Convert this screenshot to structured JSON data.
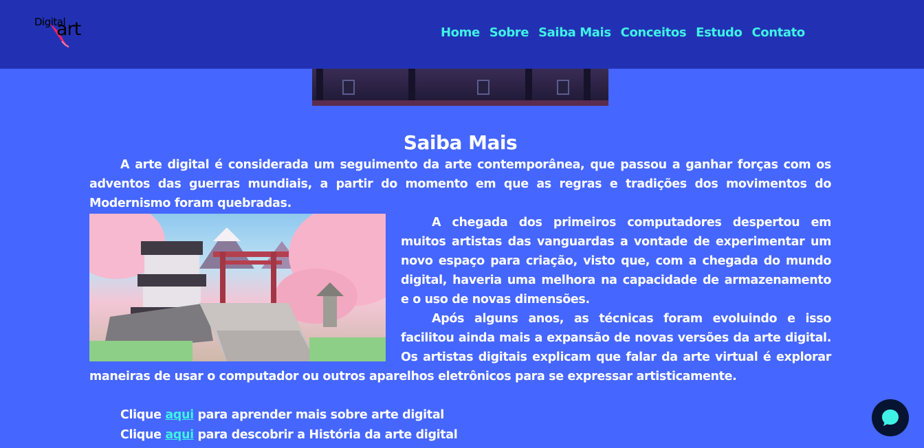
{
  "header": {
    "logo": {
      "line1": "Digital",
      "line2": "art",
      "brand_pink": "#e8236a"
    },
    "nav": [
      {
        "label": "Home"
      },
      {
        "label": "Sobre"
      },
      {
        "label": "Saiba Mais"
      },
      {
        "label": "Conceitos"
      },
      {
        "label": "Estudo"
      },
      {
        "label": "Contato"
      }
    ]
  },
  "colors": {
    "page_background": "#4566ff",
    "header_background": "#2231b4",
    "nav_link": "#3ff2e6",
    "chat_button": "#061431"
  },
  "main": {
    "top_image_icon": "pixel-art-scene-image",
    "title": "Saiba Mais",
    "paragraph1": "A arte digital é considerada um seguimento da arte contemporânea, que passou a ganhar forças com os adventos das guerras mundiais, a partir do momento em que as regras e tradições dos movimentos do Modernismo foram quebradas.",
    "image_icon": "cherry-blossom-castle-pixel-art-image",
    "paragraph2": "A chegada dos primeiros computadores despertou em muitos artistas das vanguardas a vontade de experimentar um novo espaço para criação, visto que, com a chegada do mundo digital, haveria uma melhora na capacidade de armazenamento e o uso de novas dimensões.",
    "paragraph3": "Após alguns anos, as técnicas foram evoluindo e isso facilitou ainda mais a expansão de novas versões da arte digital. Os artistas digitais explicam que falar da arte virtual é explorar maneiras de usar o computador ou outros aparelhos eletrônicos para se expressar artisticamente.",
    "links": [
      {
        "prefix": "Clique ",
        "link": "aqui",
        "suffix": " para aprender mais sobre arte digital"
      },
      {
        "prefix": "Clique ",
        "link": "aqui",
        "suffix": " para descobrir a História da arte digital"
      }
    ]
  },
  "chat": {
    "icon": "chat-bubble-icon"
  }
}
